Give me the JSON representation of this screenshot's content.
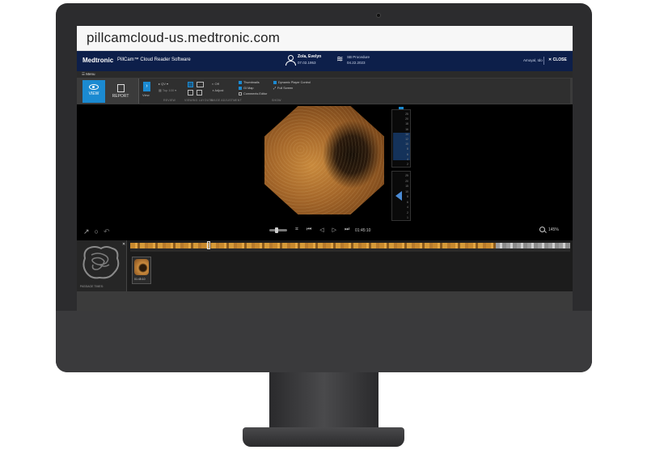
{
  "browser": {
    "url": "pillcamcloud-us.medtronic.com"
  },
  "header": {
    "brand": "Medtronic",
    "app_title": "PillCam™ Cloud Reader Software",
    "patient_name": "Zola, Evelyn",
    "patient_dob": "07.02.1953",
    "procedure_name": "SB Procedure",
    "procedure_date": "04.22.2023",
    "user": "Amoyal, Ido",
    "close_label": "CLOSE"
  },
  "menu": {
    "label": "Menu"
  },
  "toolbar": {
    "view_label": "VIEW",
    "report_label": "REPORT",
    "view_small_label": "View",
    "mode_qv": "QV",
    "mode_top": "Top 100",
    "group_review": "REVIEW",
    "group_viewing_layouts": "VIEWING LAYOUTS",
    "group_image_adjustment": "IMAGE ADJUSTMENT",
    "group_show": "SHOW",
    "adjust_off": "Off",
    "adjust_label": "Adjust",
    "show_thumbnails": "Thumbnails",
    "show_gi_map": "GI Map",
    "show_comments": "Comments Editor",
    "show_dynamic": "Dynamic Player Control",
    "show_fullscreen": "Full Screen",
    "show_states": {
      "thumbnails": true,
      "gi_map": true,
      "comments": false,
      "dynamic": true
    }
  },
  "gauge": {
    "top_ticks": [
      "25",
      "20",
      "18",
      "16",
      "14",
      "12",
      "10",
      "8",
      "6",
      "4",
      "2"
    ],
    "bottom_ticks": [
      "25",
      "20",
      "15",
      "10",
      "8",
      "6",
      "4",
      "2",
      "1"
    ]
  },
  "player": {
    "timecode": "01:45:10",
    "zoom": "145%"
  },
  "bottom": {
    "passage_label": "PASSAGE TIMES:",
    "thumbnail_time": "01:45:10"
  },
  "colors": {
    "accent": "#1b8ad1",
    "header_bg": "#0d1f4a"
  }
}
